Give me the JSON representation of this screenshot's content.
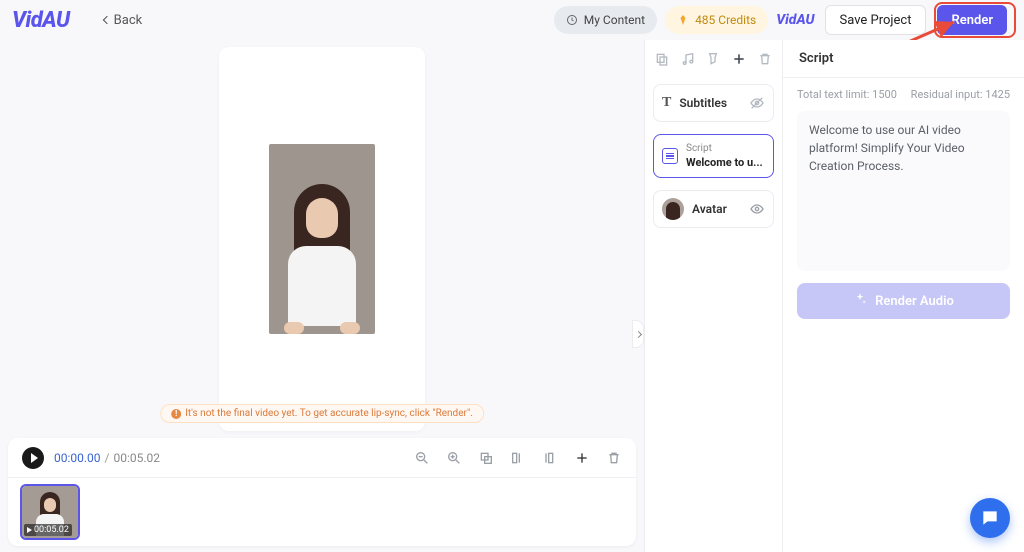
{
  "header": {
    "logo_text": "VidAU",
    "back_label": "Back",
    "my_content_label": "My Content",
    "credits_label": "485 Credits",
    "mini_logo": "VidAU",
    "save_label": "Save Project",
    "render_label": "Render"
  },
  "canvas": {
    "warning_text": "It's not the final video yet. To get accurate lip-sync, click \"Render\"."
  },
  "timeline": {
    "current_time": "00:00.00",
    "duration": "00:05.02",
    "thumb_timestamp": "00:05.02"
  },
  "layers": {
    "subtitles_label": "Subtitles",
    "script_small_label": "Script",
    "script_preview": "Welcome to u...",
    "avatar_label": "Avatar"
  },
  "script_panel": {
    "title": "Script",
    "total_limit_label": "Total text limit: 1500",
    "residual_label": "Residual input: 1425",
    "script_text": "Welcome to use our AI video platform! Simplify Your Video Creation Process.",
    "render_audio_label": "Render Audio"
  }
}
